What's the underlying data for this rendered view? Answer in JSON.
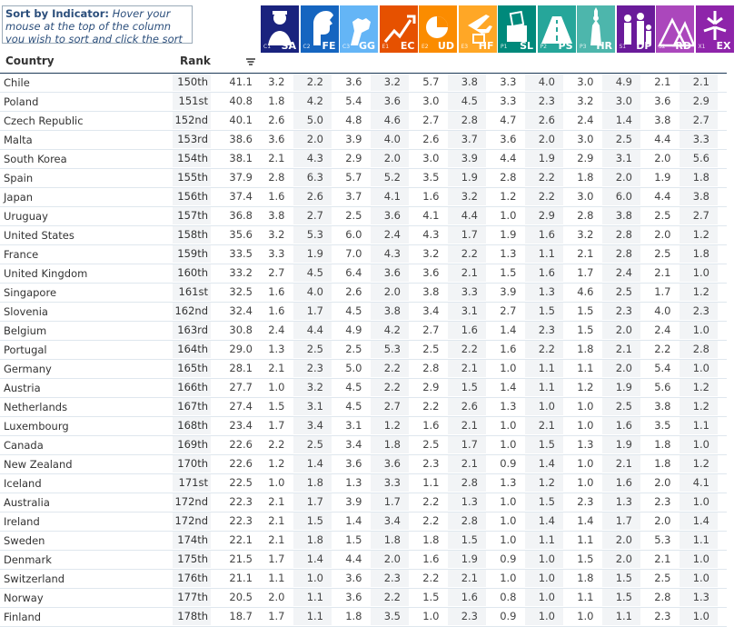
{
  "sort_box": {
    "title": "Sort by Indicator:",
    "hint": "Hover your mouse at the top of the column you wish to sort and click the sort button"
  },
  "columns": {
    "country": "Country",
    "rank": "Rank"
  },
  "indicators": [
    {
      "code": "SA",
      "sub": "C1",
      "color": "#1a237e",
      "icon": "police-officer-icon"
    },
    {
      "code": "FE",
      "sub": "C2",
      "color": "#1565c0",
      "icon": "face-profile-icon"
    },
    {
      "code": "GG",
      "sub": "C3",
      "color": "#64b5f6",
      "icon": "raised-fist-icon"
    },
    {
      "code": "EC",
      "sub": "E1",
      "color": "#e65100",
      "icon": "rising-chart-icon"
    },
    {
      "code": "UD",
      "sub": "E2",
      "color": "#fb8c00",
      "icon": "pie-chart-icon"
    },
    {
      "code": "HF",
      "sub": "E3",
      "color": "#ffa726",
      "icon": "airplane-suitcase-icon"
    },
    {
      "code": "SL",
      "sub": "P1",
      "color": "#00897b",
      "icon": "ballot-box-icon"
    },
    {
      "code": "PS",
      "sub": "P2",
      "color": "#26a69a",
      "icon": "road-icon"
    },
    {
      "code": "HR",
      "sub": "P3",
      "color": "#4db6ac",
      "icon": "liberty-statue-icon"
    },
    {
      "code": "DP",
      "sub": "S1",
      "color": "#6a1b9a",
      "icon": "family-people-icon"
    },
    {
      "code": "RD",
      "sub": "S2",
      "color": "#ab47bc",
      "icon": "tents-icon"
    },
    {
      "code": "EX",
      "sub": "X1",
      "color": "#8e24aa",
      "icon": "intervention-arrows-icon"
    }
  ],
  "rows": [
    {
      "country": "Chile",
      "rank": "150th",
      "score": "41.1",
      "vals": [
        "3.2",
        "2.2",
        "3.6",
        "3.2",
        "5.7",
        "3.8",
        "3.3",
        "4.0",
        "3.0",
        "4.9",
        "2.1",
        "2.1"
      ]
    },
    {
      "country": "Poland",
      "rank": "151st",
      "score": "40.8",
      "vals": [
        "1.8",
        "4.2",
        "5.4",
        "3.6",
        "3.0",
        "4.5",
        "3.3",
        "2.3",
        "3.2",
        "3.0",
        "3.6",
        "2.9"
      ]
    },
    {
      "country": "Czech Republic",
      "rank": "152nd",
      "score": "40.1",
      "vals": [
        "2.6",
        "5.0",
        "4.8",
        "4.6",
        "2.7",
        "2.8",
        "4.7",
        "2.6",
        "2.4",
        "1.4",
        "3.8",
        "2.7"
      ]
    },
    {
      "country": "Malta",
      "rank": "153rd",
      "score": "38.6",
      "vals": [
        "3.6",
        "2.0",
        "3.9",
        "4.0",
        "2.6",
        "3.7",
        "3.6",
        "2.0",
        "3.0",
        "2.5",
        "4.4",
        "3.3"
      ]
    },
    {
      "country": "South Korea",
      "rank": "154th",
      "score": "38.1",
      "vals": [
        "2.1",
        "4.3",
        "2.9",
        "2.0",
        "3.0",
        "3.9",
        "4.4",
        "1.9",
        "2.9",
        "3.1",
        "2.0",
        "5.6"
      ]
    },
    {
      "country": "Spain",
      "rank": "155th",
      "score": "37.9",
      "vals": [
        "2.8",
        "6.3",
        "5.7",
        "5.2",
        "3.5",
        "1.9",
        "2.8",
        "2.2",
        "1.8",
        "2.0",
        "1.9",
        "1.8"
      ]
    },
    {
      "country": "Japan",
      "rank": "156th",
      "score": "37.4",
      "vals": [
        "1.6",
        "2.6",
        "3.7",
        "4.1",
        "1.6",
        "3.2",
        "1.2",
        "2.2",
        "3.0",
        "6.0",
        "4.4",
        "3.8"
      ]
    },
    {
      "country": "Uruguay",
      "rank": "157th",
      "score": "36.8",
      "vals": [
        "3.8",
        "2.7",
        "2.5",
        "3.6",
        "4.1",
        "4.4",
        "1.0",
        "2.9",
        "2.8",
        "3.8",
        "2.5",
        "2.7"
      ]
    },
    {
      "country": "United States",
      "rank": "158th",
      "score": "35.6",
      "vals": [
        "3.2",
        "5.3",
        "6.0",
        "2.4",
        "4.3",
        "1.7",
        "1.9",
        "1.6",
        "3.2",
        "2.8",
        "2.0",
        "1.2"
      ]
    },
    {
      "country": "France",
      "rank": "159th",
      "score": "33.5",
      "vals": [
        "3.3",
        "1.9",
        "7.0",
        "4.3",
        "3.2",
        "2.2",
        "1.3",
        "1.1",
        "2.1",
        "2.8",
        "2.5",
        "1.8"
      ]
    },
    {
      "country": "United Kingdom",
      "rank": "160th",
      "score": "33.2",
      "vals": [
        "2.7",
        "4.5",
        "6.4",
        "3.6",
        "3.6",
        "2.1",
        "1.5",
        "1.6",
        "1.7",
        "2.4",
        "2.1",
        "1.0"
      ]
    },
    {
      "country": "Singapore",
      "rank": "161st",
      "score": "32.5",
      "vals": [
        "1.6",
        "4.0",
        "2.6",
        "2.0",
        "3.8",
        "3.3",
        "3.9",
        "1.3",
        "4.6",
        "2.5",
        "1.7",
        "1.2"
      ]
    },
    {
      "country": "Slovenia",
      "rank": "162nd",
      "score": "32.4",
      "vals": [
        "1.6",
        "1.7",
        "4.5",
        "3.8",
        "3.4",
        "3.1",
        "2.7",
        "1.5",
        "1.5",
        "2.3",
        "4.0",
        "2.3"
      ]
    },
    {
      "country": "Belgium",
      "rank": "163rd",
      "score": "30.8",
      "vals": [
        "2.4",
        "4.4",
        "4.9",
        "4.2",
        "2.7",
        "1.6",
        "1.4",
        "2.3",
        "1.5",
        "2.0",
        "2.4",
        "1.0"
      ]
    },
    {
      "country": "Portugal",
      "rank": "164th",
      "score": "29.0",
      "vals": [
        "1.3",
        "2.5",
        "2.5",
        "5.3",
        "2.5",
        "2.2",
        "1.6",
        "2.2",
        "1.8",
        "2.1",
        "2.2",
        "2.8"
      ]
    },
    {
      "country": "Germany",
      "rank": "165th",
      "score": "28.1",
      "vals": [
        "2.1",
        "2.3",
        "5.0",
        "2.2",
        "2.8",
        "2.1",
        "1.0",
        "1.1",
        "1.1",
        "2.0",
        "5.4",
        "1.0"
      ]
    },
    {
      "country": "Austria",
      "rank": "166th",
      "score": "27.7",
      "vals": [
        "1.0",
        "3.2",
        "4.5",
        "2.2",
        "2.9",
        "1.5",
        "1.4",
        "1.1",
        "1.2",
        "1.9",
        "5.6",
        "1.2"
      ]
    },
    {
      "country": "Netherlands",
      "rank": "167th",
      "score": "27.4",
      "vals": [
        "1.5",
        "3.1",
        "4.5",
        "2.7",
        "2.2",
        "2.6",
        "1.3",
        "1.0",
        "1.0",
        "2.5",
        "3.8",
        "1.2"
      ]
    },
    {
      "country": "Luxembourg",
      "rank": "168th",
      "score": "23.4",
      "vals": [
        "1.7",
        "3.4",
        "3.1",
        "1.2",
        "1.6",
        "2.1",
        "1.0",
        "2.1",
        "1.0",
        "1.6",
        "3.5",
        "1.1"
      ]
    },
    {
      "country": "Canada",
      "rank": "169th",
      "score": "22.6",
      "vals": [
        "2.2",
        "2.5",
        "3.4",
        "1.8",
        "2.5",
        "1.7",
        "1.0",
        "1.5",
        "1.3",
        "1.9",
        "1.8",
        "1.0"
      ]
    },
    {
      "country": "New Zealand",
      "rank": "170th",
      "score": "22.6",
      "vals": [
        "1.2",
        "1.4",
        "3.6",
        "3.6",
        "2.3",
        "2.1",
        "0.9",
        "1.4",
        "1.0",
        "2.1",
        "1.8",
        "1.2"
      ]
    },
    {
      "country": "Iceland",
      "rank": "171st",
      "score": "22.5",
      "vals": [
        "1.0",
        "1.8",
        "1.3",
        "3.3",
        "1.1",
        "2.8",
        "1.3",
        "1.2",
        "1.0",
        "1.6",
        "2.0",
        "4.1"
      ]
    },
    {
      "country": "Australia",
      "rank": "172nd",
      "score": "22.3",
      "vals": [
        "2.1",
        "1.7",
        "3.9",
        "1.7",
        "2.2",
        "1.3",
        "1.0",
        "1.5",
        "2.3",
        "1.3",
        "2.3",
        "1.0"
      ]
    },
    {
      "country": "Ireland",
      "rank": "172nd",
      "score": "22.3",
      "vals": [
        "2.1",
        "1.5",
        "1.4",
        "3.4",
        "2.2",
        "2.8",
        "1.0",
        "1.4",
        "1.4",
        "1.7",
        "2.0",
        "1.4"
      ]
    },
    {
      "country": "Sweden",
      "rank": "174th",
      "score": "22.1",
      "vals": [
        "2.1",
        "1.8",
        "1.5",
        "1.8",
        "1.8",
        "1.5",
        "1.0",
        "1.1",
        "1.1",
        "2.0",
        "5.3",
        "1.1"
      ]
    },
    {
      "country": "Denmark",
      "rank": "175th",
      "score": "21.5",
      "vals": [
        "1.7",
        "1.4",
        "4.4",
        "2.0",
        "1.6",
        "1.9",
        "0.9",
        "1.0",
        "1.5",
        "2.0",
        "2.1",
        "1.0"
      ]
    },
    {
      "country": "Switzerland",
      "rank": "176th",
      "score": "21.1",
      "vals": [
        "1.1",
        "1.0",
        "3.6",
        "2.3",
        "2.2",
        "2.1",
        "1.0",
        "1.0",
        "1.8",
        "1.5",
        "2.5",
        "1.0"
      ]
    },
    {
      "country": "Norway",
      "rank": "177th",
      "score": "20.5",
      "vals": [
        "2.0",
        "1.1",
        "3.6",
        "2.2",
        "1.5",
        "1.6",
        "0.8",
        "1.0",
        "1.1",
        "1.5",
        "2.8",
        "1.3"
      ]
    },
    {
      "country": "Finland",
      "rank": "178th",
      "score": "18.7",
      "vals": [
        "1.7",
        "1.1",
        "1.8",
        "3.5",
        "1.0",
        "2.3",
        "0.9",
        "1.0",
        "1.0",
        "1.1",
        "2.3",
        "1.0"
      ]
    }
  ]
}
